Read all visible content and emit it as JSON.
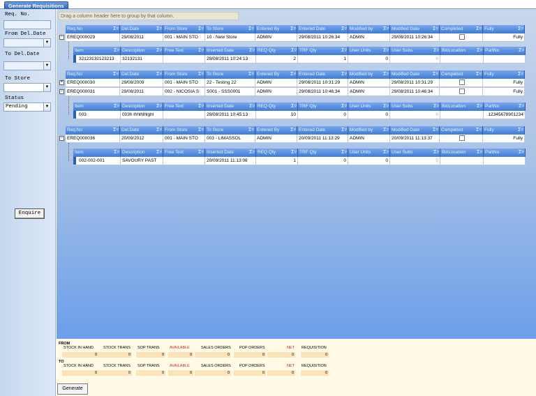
{
  "tab": "Generate Requisitions",
  "filters": {
    "req_no": "Req. No.",
    "from_del_date": "From Del.Date",
    "to_del_date": "To Del.Date",
    "to_store": "To Store",
    "status": "Status",
    "status_value": "Pending",
    "enquire": "Enquire"
  },
  "group_hint": "Drag a column header here to group by that column.",
  "master_cols": [
    "Req.No",
    "Del.Date",
    "From Store",
    "To Store",
    "Entered By",
    "Entered Date",
    "Modified by",
    "Modified Date",
    "Completed",
    "Fully"
  ],
  "detail_cols": [
    "Item",
    "Description",
    "Free Text",
    "Inserted Date",
    "REQ Qty",
    "TRF Qty",
    "User Units",
    "User Subs",
    "BinLocation",
    "PartNo"
  ],
  "groups": [
    {
      "masters": [
        [
          "EREQ000029",
          "29/08/2011",
          "001 - MAIN STO",
          "10 - New Store",
          "ADMIN",
          "29/08/2011 10:26:34",
          "ADMIN",
          "29/08/2011 10:26:34",
          "",
          "Fully"
        ]
      ],
      "details": [
        [
          "32123132123213",
          "32132131",
          "",
          "29/08/2011 10:24:13",
          "2",
          "1",
          "0",
          "0",
          "",
          ""
        ]
      ]
    },
    {
      "masters": [
        [
          "EREQ000030",
          "29/08/2009",
          "001 - MAIN STO",
          "22 - Testing 22",
          "ADMIN",
          "29/08/2011 10:31:29",
          "ADMIN",
          "29/08/2011 10:31:29",
          "",
          "Fully"
        ],
        [
          "EREQ000031",
          "29/08/2011",
          "002 - NICOSIA S",
          "S001 - SSS0001",
          "ADMIN",
          "29/08/2011 10:46:34",
          "ADMIN",
          "29/08/2011 10:46:34",
          "",
          "Fully"
        ]
      ],
      "details": [
        [
          "003",
          "003h lhhlhlhlghl",
          "",
          "29/08/2011 10:45:13",
          "10",
          "0",
          "0",
          "0",
          "",
          "12345678901234"
        ]
      ]
    },
    {
      "masters": [
        [
          "EREQ000036",
          "20/09/2012",
          "001 - MAIN STO",
          "003 - LIMASSOL",
          "ADMIN",
          "20/09/2011 11:13:29",
          "ADMIN",
          "20/09/2011 11:13:37",
          "",
          "Fully"
        ]
      ],
      "details": [
        [
          "002-002-001",
          "SAVOURY PAST",
          "",
          "20/09/2011 11:13:08",
          "1",
          "0",
          "0",
          "0",
          "",
          ""
        ]
      ]
    }
  ],
  "summary": {
    "from_label": "FROM",
    "to_label": "TO",
    "cols": [
      "STOCK IN HAND",
      "STOCK TRANS",
      "SOP TRANS",
      "AVAILABLE",
      "SALES ORDERS",
      "POP ORDERS",
      "NET",
      "REQUISITION"
    ],
    "from_vals": [
      "0",
      "0",
      "0",
      "0",
      "0",
      "0",
      "0",
      "0"
    ],
    "to_vals": [
      "0",
      "0",
      "0",
      "0",
      "0",
      "0",
      "0",
      "0"
    ]
  },
  "generate": "Generate",
  "colors": {
    "header": "#3f7bd6",
    "accent": "#2f63b8",
    "red": "#c62828",
    "summary_fill": "#fde3b8"
  }
}
